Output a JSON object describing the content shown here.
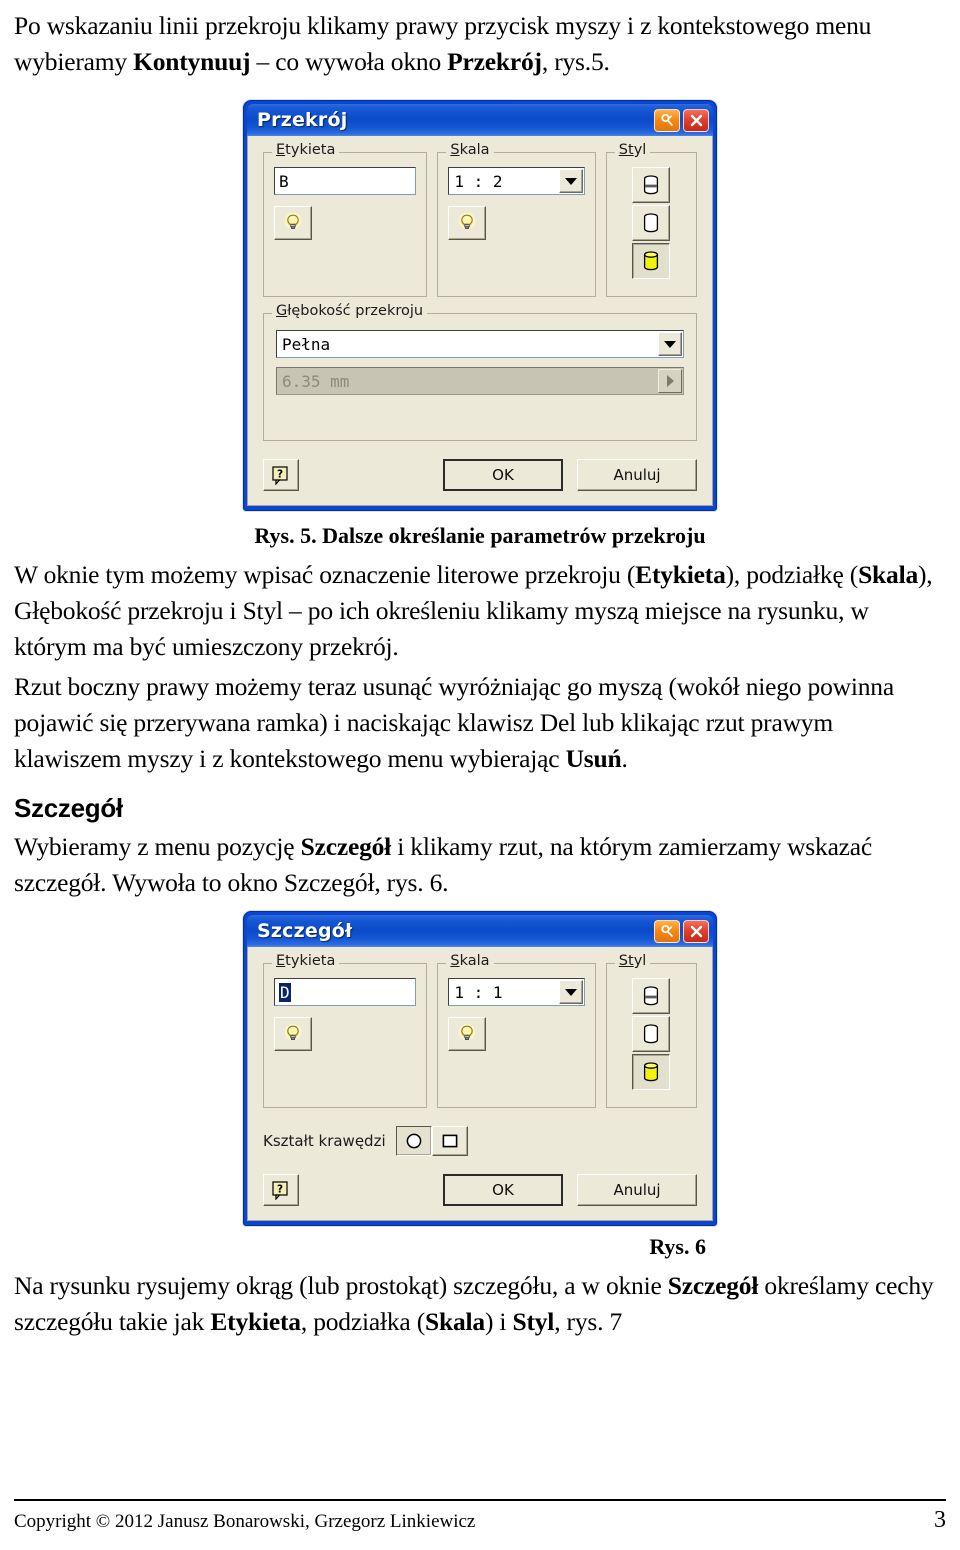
{
  "document": {
    "page_number": "3",
    "footer_copyright": "Copyright © 2012 Janusz Bonarowski, Grzegorz Linkiewicz"
  },
  "paragraphs": {
    "intro_line1": "Po wskazaniu linii przekroju klikamy prawy przycisk myszy i z kontekstowego menu",
    "intro_line2_a": "wybieramy ",
    "intro_line2_b": "Kontynuuj",
    "intro_line2_c": " – co wywoła okno ",
    "intro_line2_d": "Przekrój",
    "intro_line2_e": ", rys.5.",
    "after_fig5_a": "W oknie tym możemy wpisać oznaczenie literowe przekroju (",
    "after_fig5_b": "Etykieta",
    "after_fig5_c": "), podziałkę (",
    "after_fig5_d": "Skala",
    "after_fig5_e": "), Głębokość przekroju i Styl – po ich określeniu klikamy myszą miejsce na rysunku, w którym ma być umieszczony przekrój.",
    "delete_view_a": "Rzut boczny prawy możemy teraz usunąć wyróżniając go myszą (wokół niego powinna pojawić się przerywana ramka) i naciskając klawisz Del lub klikając rzut prawym klawiszem myszy i z kontekstowego menu wybierając ",
    "delete_view_b": "Usuń",
    "delete_view_c": ".",
    "section_heading": "Szczegół",
    "detail_intro_a": "Wybieramy z menu pozycję ",
    "detail_intro_b": "Szczegół",
    "detail_intro_c": " i klikamy rzut, na którym zamierzamy wskazać szczegół. Wywoła to okno Szczegół, rys. 6.",
    "after_fig6_a": "Na rysunku rysujemy okrąg (lub prostokąt) szczegółu, a w oknie ",
    "after_fig6_b": "Szczegół",
    "after_fig6_c": " określamy cechy szczegółu takie jak ",
    "after_fig6_d": "Etykieta",
    "after_fig6_e": ", podziałka (",
    "after_fig6_f": "Skala",
    "after_fig6_g": ") i ",
    "after_fig6_h": "Styl",
    "after_fig6_i": ", rys. 7"
  },
  "figures": {
    "fig5_caption": "Rys. 5. Dalsze określanie parametrów przekroju",
    "fig6_caption": "Rys. 6"
  },
  "dialog_przekroj": {
    "title": "Przekrój",
    "titlebar_buttons": [
      {
        "name": "help-pin-icon",
        "label": "?"
      },
      {
        "name": "close-icon",
        "label": "×"
      }
    ],
    "group_etykieta": {
      "legend_accel": "E",
      "legend_rest": "tykieta",
      "input_value": "B",
      "bulb_button_name": "lightbulb-icon"
    },
    "group_skala": {
      "legend_accel": "S",
      "legend_rest": "kala",
      "combo_value": "1 : 2",
      "bulb_button_name": "lightbulb-icon"
    },
    "group_styl": {
      "legend_accel": "St",
      "legend_rest": "yl",
      "style_buttons": [
        {
          "name": "style-hatched-cylinder",
          "selected": false
        },
        {
          "name": "style-plain-cylinder",
          "selected": false
        },
        {
          "name": "style-yellow-cylinder",
          "selected": true
        }
      ]
    },
    "group_depth": {
      "legend_accel": "G",
      "legend_rest": "łębokość przekroju",
      "combo_value": "Pełna",
      "spinner_value": "6.35 mm",
      "spinner_enabled": false
    },
    "buttons": {
      "help": "?",
      "ok": "OK",
      "cancel": "Anuluj"
    }
  },
  "dialog_szczegol": {
    "title": "Szczegół",
    "titlebar_buttons": [
      {
        "name": "help-pin-icon",
        "label": "?"
      },
      {
        "name": "close-icon",
        "label": "×"
      }
    ],
    "group_etykieta": {
      "legend_accel": "E",
      "legend_rest": "tykieta",
      "input_value": "D",
      "input_selected": true,
      "bulb_button_name": "lightbulb-icon"
    },
    "group_skala": {
      "legend_accel": "S",
      "legend_rest": "kala",
      "combo_value": "1 : 1",
      "bulb_button_name": "lightbulb-icon"
    },
    "group_styl": {
      "legend_accel": "St",
      "legend_rest": "yl",
      "style_buttons": [
        {
          "name": "style-hatched-cylinder",
          "selected": false
        },
        {
          "name": "style-plain-cylinder",
          "selected": false
        },
        {
          "name": "style-yellow-cylinder",
          "selected": true
        }
      ]
    },
    "edge_shape": {
      "label": "Kształt krawędzi",
      "options": [
        {
          "name": "circle-edge-icon",
          "selected": true
        },
        {
          "name": "square-edge-icon",
          "selected": false
        }
      ]
    },
    "buttons": {
      "help": "?",
      "ok": "OK",
      "cancel": "Anuluj"
    }
  },
  "colors": {
    "titlebar_blue": "#0b4bcb",
    "dialog_face": "#ece9d8",
    "help_button_orange": "#f58a16",
    "close_button_red": "#e0412c",
    "selection_blue": "#0a246a",
    "style_yellow": "#f2f20a"
  }
}
